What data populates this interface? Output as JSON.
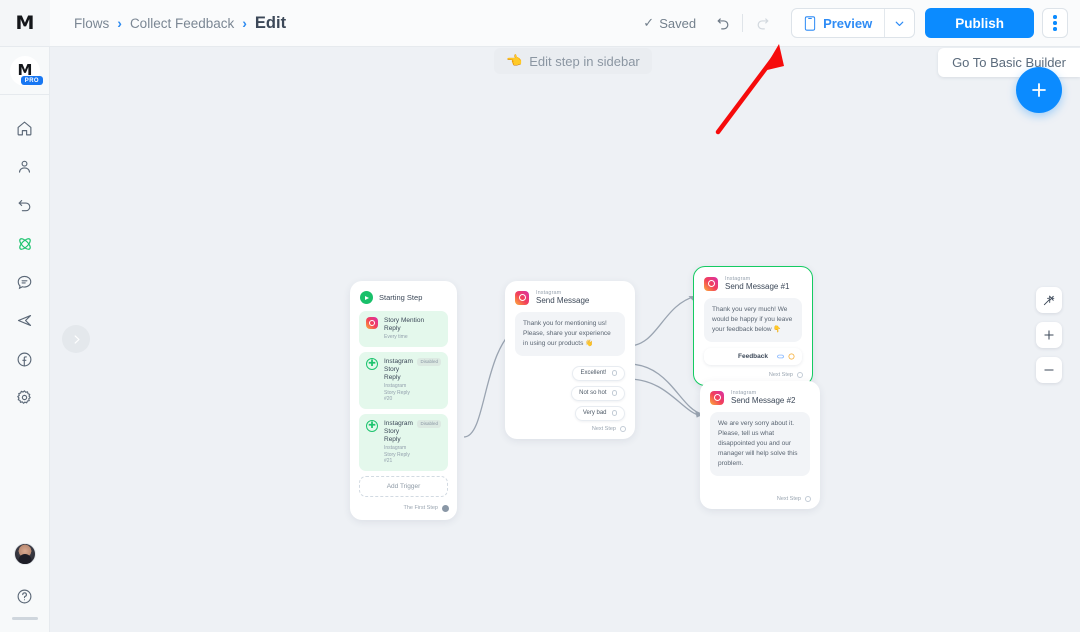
{
  "app": {
    "logo_text": "M",
    "pro_badge": "PRO"
  },
  "breadcrumb": {
    "items": [
      "Flows",
      "Collect Feedback"
    ],
    "separator": "›",
    "current": "Edit"
  },
  "topbar": {
    "saved_label": "Saved",
    "saved_check": "✓",
    "undo_icon": "undo-icon",
    "redo_icon": "redo-icon",
    "preview_label": "Preview",
    "preview_icon": "mobile-preview-icon",
    "caret_icon": "chevron-down-icon",
    "publish_label": "Publish",
    "kebab_icon": "more-options-icon"
  },
  "sidebar": {
    "items": [
      {
        "name": "home",
        "icon": "home-icon"
      },
      {
        "name": "contacts",
        "icon": "user-icon"
      },
      {
        "name": "automation",
        "icon": "undo-arrow-icon"
      },
      {
        "name": "flows",
        "icon": "flow-atom-icon",
        "active": true,
        "color": "#1ec46f"
      },
      {
        "name": "live-chat",
        "icon": "chat-bubble-icon"
      },
      {
        "name": "broadcast",
        "icon": "send-paper-plane-icon"
      },
      {
        "name": "facebook",
        "icon": "facebook-icon"
      },
      {
        "name": "settings",
        "icon": "gear-icon"
      }
    ],
    "bottom": [
      {
        "name": "profile",
        "icon": "avatar"
      },
      {
        "name": "help",
        "icon": "question-mark-icon"
      }
    ]
  },
  "canvas": {
    "edit_hint": {
      "label": "Edit step in sidebar",
      "icon": "pointing-hand-icon",
      "emoji": "👈"
    },
    "basic_builder_label": "Go To Basic Builder",
    "add_button_icon": "plus-icon",
    "zoom_controls": [
      {
        "name": "auto-layout",
        "icon": "magic-wand-icon"
      },
      {
        "name": "zoom-in",
        "icon": "plus-icon",
        "glyph": "+"
      },
      {
        "name": "zoom-out",
        "icon": "minus-icon",
        "glyph": "−"
      }
    ],
    "collapse_icon": "chevron-right-icon"
  },
  "nodes": {
    "starting_step": {
      "title": "Starting Step",
      "icon": "play-circle-icon",
      "triggers": [
        {
          "name": "Story Mention Reply",
          "meta": "Every time",
          "icon": "instagram-icon",
          "badge": null
        },
        {
          "name": "Instagram Story Reply",
          "meta": "Instagram Story Reply #20",
          "icon": "instagram-story-icon",
          "badge": "Disabled"
        },
        {
          "name": "Instagram Story Reply",
          "meta": "Instagram Story Reply #21",
          "icon": "instagram-story-icon",
          "badge": "Disabled"
        }
      ],
      "add_trigger_label": "Add Trigger",
      "footer_label": "The First Step"
    },
    "send_message": {
      "channel": "Instagram",
      "title": "Send Message",
      "message": "Thank you for mentioning us! Please, share your experience in using our products 👋",
      "quick_replies": [
        "Excellent!",
        "Not so hot",
        "Very bad"
      ],
      "footer_label": "Next Step"
    },
    "send_message_1": {
      "channel": "Instagram",
      "title": "Send Message #1",
      "message": "Thank you very much! We would be happy if you leave your feedback below 👇",
      "button_label": "Feedback",
      "footer_label": "Next Step",
      "selected": true,
      "selection_color": "#14cb62"
    },
    "send_message_2": {
      "channel": "Instagram",
      "title": "Send Message #2",
      "message": "We are very sorry about it. Please, tell us what disappointed you and our manager will help solve this problem.",
      "footer_label": "Next Step"
    }
  },
  "annotation": {
    "type": "arrow",
    "color": "#f60b0b",
    "points_to": "preview-button"
  },
  "colors": {
    "accent_blue": "#0b8bff",
    "canvas_bg": "#eef1f5",
    "green": "#1ec46f",
    "trigger_bg": "#e4f8ec"
  }
}
